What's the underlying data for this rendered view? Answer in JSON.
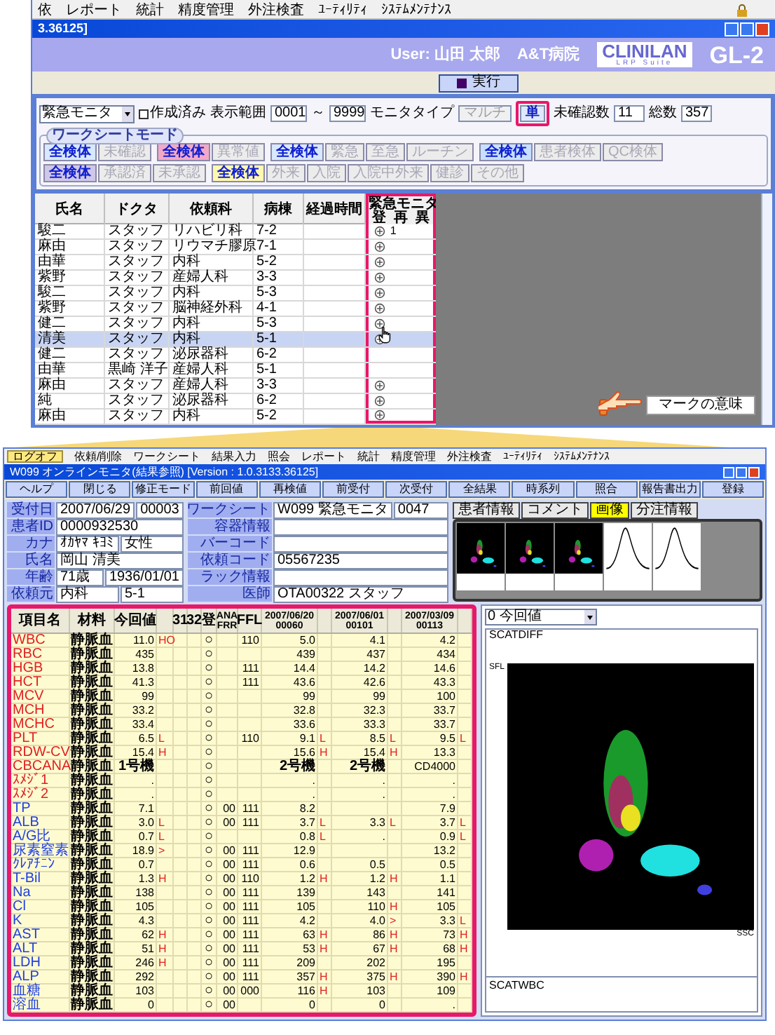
{
  "top_window": {
    "menu": [
      "依",
      "レポート",
      "統計",
      "精度管理",
      "外注検査",
      "ﾕｰﾃｨﾘﾃｨ",
      "ｼｽﾃﾑﾒﾝﾃﾅﾝｽ"
    ],
    "title": "3.36125]",
    "user": "User: 山田 太郎",
    "hospital": "A&T病院",
    "logo": "CLINILAN",
    "logo_sub": "LRP Suite",
    "product": "GL-2",
    "run_button": "実行",
    "filter": {
      "worksheet": "緊急モニタ",
      "created": {
        "label": "作成済み",
        "checked": false
      },
      "range_label": "表示範囲",
      "range_from": "0001",
      "range_sep": "～",
      "range_to": "9999",
      "type_label": "モニタタイプ",
      "types": [
        {
          "label": "マルチ",
          "selected": false
        },
        {
          "label": "単",
          "selected": true
        }
      ],
      "unconfirmed_label": "未確認数",
      "unconfirmed": "11",
      "total_label": "総数",
      "total": "357"
    },
    "mode_group": {
      "title": "ワークシートモード",
      "rows": [
        [
          {
            "color": "#d8e8ff",
            "buttons": [
              {
                "label": "全検体",
                "selected": true
              },
              {
                "label": "未確認",
                "selected": false
              }
            ]
          },
          {
            "color": "#f4a8c8",
            "buttons": [
              {
                "label": "全検体",
                "selected": true
              },
              {
                "label": "異常値",
                "selected": false
              }
            ]
          },
          {
            "color": "#d8e8ff",
            "buttons": [
              {
                "label": "全検体",
                "selected": true
              },
              {
                "label": "緊急",
                "selected": false
              },
              {
                "label": "至急",
                "selected": false
              },
              {
                "label": "ルーチン",
                "selected": false
              }
            ]
          },
          {
            "color": "#c8e0ff",
            "buttons": [
              {
                "label": "全検体",
                "selected": true
              },
              {
                "label": "患者検体",
                "selected": false
              },
              {
                "label": "QC検体",
                "selected": false
              }
            ]
          }
        ],
        [
          {
            "color": "#d0c8e8",
            "buttons": [
              {
                "label": "全検体",
                "selected": true
              },
              {
                "label": "承認済",
                "selected": false
              },
              {
                "label": "未承認",
                "selected": false
              }
            ]
          },
          {
            "color": "#fff8b0",
            "buttons": [
              {
                "label": "全検体",
                "selected": true
              },
              {
                "label": "外来",
                "selected": false
              },
              {
                "label": "入院",
                "selected": false
              },
              {
                "label": "入院中外来",
                "selected": false
              },
              {
                "label": "健診",
                "selected": false
              },
              {
                "label": "その他",
                "selected": false
              }
            ]
          }
        ]
      ]
    },
    "table": {
      "columns": [
        "氏名",
        "ドクタ",
        "依頼科",
        "病棟",
        "経過時間"
      ],
      "monitor_title": "緊急モニタ",
      "monitor_columns": [
        "登",
        "再",
        "異"
      ],
      "rows": [
        {
          "cells": [
            "駿二",
            "スタッフ",
            "リハビリ科",
            "7-2"
          ],
          "mark": true,
          "recheck": "1",
          "selected": false
        },
        {
          "cells": [
            "麻由",
            "スタッフ",
            "リウマチ膠原",
            "7-1"
          ],
          "mark": true,
          "selected": false
        },
        {
          "cells": [
            "由華",
            "スタッフ",
            "内科",
            "5-2"
          ],
          "mark": true,
          "selected": false
        },
        {
          "cells": [
            "紫野",
            "スタッフ",
            "産婦人科",
            "3-3"
          ],
          "mark": true,
          "selected": false
        },
        {
          "cells": [
            "駿二",
            "スタッフ",
            "内科",
            "5-3"
          ],
          "mark": true,
          "selected": false
        },
        {
          "cells": [
            "紫野",
            "スタッフ",
            "脳神経外科",
            "4-1"
          ],
          "mark": true,
          "selected": false
        },
        {
          "cells": [
            "健二",
            "スタッフ",
            "内科",
            "5-3"
          ],
          "mark": true,
          "selected": false
        },
        {
          "cells": [
            "清美",
            "スタッフ",
            "内科",
            "5-1"
          ],
          "mark": true,
          "selected": true
        },
        {
          "cells": [
            "健二",
            "スタッフ",
            "泌尿器科",
            "6-2"
          ],
          "mark": false,
          "selected": false
        },
        {
          "cells": [
            "由華",
            "黒崎 洋子",
            "産婦人科",
            "5-1"
          ],
          "mark": false,
          "selected": false
        },
        {
          "cells": [
            "麻由",
            "スタッフ",
            "産婦人科",
            "3-3"
          ],
          "mark": true,
          "selected": false
        },
        {
          "cells": [
            "純",
            "スタッフ",
            "泌尿器科",
            "6-2"
          ],
          "mark": true,
          "selected": false
        },
        {
          "cells": [
            "麻由",
            "スタッフ",
            "内科",
            "5-2"
          ],
          "mark": true,
          "selected": false
        }
      ]
    },
    "callout": "マークの意味"
  },
  "bottom_window": {
    "logoff": "ログオフ",
    "menu": [
      "依頼/削除",
      "ワークシート",
      "結果入力",
      "照会",
      "レポート",
      "統計",
      "精度管理",
      "外注検査",
      "ﾕｰﾃｨﾘﾃｨ",
      "ｼｽﾃﾑﾒﾝﾃﾅﾝｽ"
    ],
    "title": "W099 オンラインモニタ(結果参照) [Version : 1.0.3133.36125]",
    "toolbar": [
      "ヘルプ",
      "閉じる",
      "修正モード",
      "前回値",
      "再検値",
      "前受付",
      "次受付",
      "全結果",
      "時系列",
      "照合",
      "報告書出力",
      "登録"
    ],
    "info_left": [
      {
        "label": "受付日",
        "values": [
          "2007/06/29",
          "00003"
        ]
      },
      {
        "label": "患者ID",
        "values": [
          "0000932530"
        ]
      },
      {
        "label": "カナ",
        "values": [
          "ｵｶﾔﾏ ｷﾖﾐ",
          "女性"
        ]
      },
      {
        "label": "氏名",
        "values": [
          "岡山 清美"
        ]
      },
      {
        "label": "年齢",
        "values": [
          "71歳",
          "1936/01/01"
        ]
      },
      {
        "label": "依頼元",
        "values": [
          "内科",
          "5-1"
        ]
      }
    ],
    "info_mid": [
      {
        "label": "ワークシート",
        "values": [
          "W099 緊急モニタ",
          "0047"
        ]
      },
      {
        "label": "容器情報"
      },
      {
        "label": "バーコード"
      },
      {
        "label": "依頼コード",
        "values": [
          "05567235"
        ]
      },
      {
        "label": "ラック情報"
      },
      {
        "label": "医師",
        "values": [
          "OTA00322 スタッフ"
        ]
      }
    ],
    "tabs": [
      {
        "label": "患者情報",
        "selected": false
      },
      {
        "label": "コメント",
        "selected": false
      },
      {
        "label": "画像",
        "selected": true
      },
      {
        "label": "分注情報",
        "selected": false
      }
    ],
    "thumbnails": [
      {
        "kind": "scatter"
      },
      {
        "kind": "scatter"
      },
      {
        "kind": "scatter"
      },
      {
        "kind": "curve"
      },
      {
        "kind": "curve"
      }
    ],
    "results": {
      "columns": [
        {
          "kind": "text",
          "label": "項目名"
        },
        {
          "kind": "text",
          "label": "材料"
        },
        {
          "kind": "text",
          "label": "今回値"
        },
        {
          "kind": "flag"
        },
        {
          "kind": "text",
          "label": "31"
        },
        {
          "kind": "text",
          "label": "32"
        },
        {
          "kind": "text",
          "label": "登"
        },
        {
          "kind": "text",
          "label": "ANA",
          "sub": "FRR"
        },
        {
          "kind": "text",
          "label": "FFL"
        },
        {
          "kind": "text",
          "label": "2007/06/20",
          "sub": "00060"
        },
        {
          "kind": "flag"
        },
        {
          "kind": "text",
          "label": "2007/06/01",
          "sub": "00101"
        },
        {
          "kind": "flag"
        },
        {
          "kind": "text",
          "label": "2007/03/09",
          "sub": "00113"
        },
        {
          "kind": "flag"
        }
      ],
      "rows": [
        {
          "name": "WBC",
          "color": "#e02020",
          "cells": {
            "m": "静脈血",
            "v": "11.0",
            "f": "HO",
            "r": "○",
            "ffl": "110",
            "r1": "5.0",
            "r2": "4.1",
            "r3": "4.2"
          }
        },
        {
          "name": "RBC",
          "color": "#e02020",
          "cells": {
            "m": "静脈血",
            "v": "435",
            "r": "○",
            "r1": "439",
            "r2": "437",
            "r3": "434"
          }
        },
        {
          "name": "HGB",
          "color": "#e02020",
          "cells": {
            "m": "静脈血",
            "v": "13.8",
            "r": "○",
            "ffl": "111",
            "r1": "14.4",
            "r2": "14.2",
            "r3": "14.6"
          }
        },
        {
          "name": "HCT",
          "color": "#e02020",
          "cells": {
            "m": "静脈血",
            "v": "41.3",
            "r": "○",
            "ffl": "111",
            "r1": "43.6",
            "r2": "42.6",
            "r3": "43.3"
          }
        },
        {
          "name": "MCV",
          "color": "#e02020",
          "cells": {
            "m": "静脈血",
            "v": "99",
            "r": "○",
            "r1": "99",
            "r2": "99",
            "r3": "100"
          }
        },
        {
          "name": "MCH",
          "color": "#e02020",
          "cells": {
            "m": "静脈血",
            "v": "33.2",
            "r": "○",
            "r1": "32.8",
            "r2": "32.3",
            "r3": "33.7"
          }
        },
        {
          "name": "MCHC",
          "color": "#e02020",
          "cells": {
            "m": "静脈血",
            "v": "33.4",
            "r": "○",
            "r1": "33.6",
            "r2": "33.3",
            "r3": "33.7"
          }
        },
        {
          "name": "PLT",
          "color": "#e02020",
          "cells": {
            "m": "静脈血",
            "v": "6.5",
            "f": "L",
            "r": "○",
            "ffl": "110",
            "r1": "9.1",
            "f1": "L",
            "r2": "8.5",
            "f2": "L",
            "r3": "9.5",
            "f3": "L"
          }
        },
        {
          "name": "RDW-CV",
          "color": "#e02020",
          "cells": {
            "m": "静脈血",
            "v": "15.4",
            "f": "H",
            "r": "○",
            "r1": "15.6",
            "f1": "H",
            "r2": "15.4",
            "f2": "H",
            "r3": "13.3"
          }
        },
        {
          "name": "CBCANA",
          "color": "#e02020",
          "cells": {
            "m": "静脈血",
            "v": "1号機",
            "r": "○",
            "r1": "2号機",
            "r2": "2号機",
            "r3": "CD4000"
          }
        },
        {
          "name": "ｽﾒｼﾞ1",
          "color": "#e02020",
          "cells": {
            "m": "静脈血",
            "v": ".",
            "r": "○",
            "r1": ".",
            "r2": ".",
            "r3": "."
          }
        },
        {
          "name": "ｽﾒｼﾞ2",
          "color": "#e02020",
          "cells": {
            "m": "静脈血",
            "v": ".",
            "r": "○",
            "r1": ".",
            "r2": ".",
            "r3": "."
          }
        },
        {
          "name": "TP",
          "color": "#2040e0",
          "cells": {
            "m": "静脈血",
            "v": "7.1",
            "r": "○",
            "ana": "00",
            "ffl": "111",
            "r1": "8.2",
            "r3": "7.9"
          }
        },
        {
          "name": "ALB",
          "color": "#2040e0",
          "cells": {
            "m": "静脈血",
            "v": "3.0",
            "f": "L",
            "r": "○",
            "ana": "00",
            "ffl": "111",
            "r1": "3.7",
            "f1": "L",
            "r2": "3.3",
            "f2": "L",
            "r3": "3.7",
            "f3": "L"
          }
        },
        {
          "name": "A/G比",
          "color": "#2040e0",
          "cells": {
            "m": "静脈血",
            "v": "0.7",
            "f": "L",
            "r": "○",
            "r1": "0.8",
            "f1": "L",
            "r2": ".",
            "r3": "0.9",
            "f3": "L"
          }
        },
        {
          "name": "尿素窒素",
          "color": "#2040e0",
          "cells": {
            "m": "静脈血",
            "v": "18.9",
            "f": ">",
            "r": "○",
            "ana": "00",
            "ffl": "111",
            "r1": "12.9",
            "r3": "13.2"
          }
        },
        {
          "name": "ｸﾚｱﾁﾆﾝ",
          "color": "#2040e0",
          "cells": {
            "m": "静脈血",
            "v": "0.7",
            "r": "○",
            "ana": "00",
            "ffl": "111",
            "r1": "0.6",
            "r2": "0.5",
            "r3": "0.5"
          }
        },
        {
          "name": "T-Bil",
          "color": "#2040e0",
          "cells": {
            "m": "静脈血",
            "v": "1.3",
            "f": "H",
            "r": "○",
            "ana": "00",
            "ffl": "110",
            "r1": "1.2",
            "f1": "H",
            "r2": "1.2",
            "f2": "H",
            "r3": "1.1"
          }
        },
        {
          "name": "Na",
          "color": "#2040e0",
          "cells": {
            "m": "静脈血",
            "v": "138",
            "r": "○",
            "ana": "00",
            "ffl": "111",
            "r1": "139",
            "r2": "143",
            "r3": "141"
          }
        },
        {
          "name": "Cl",
          "color": "#2040e0",
          "cells": {
            "m": "静脈血",
            "v": "105",
            "r": "○",
            "ana": "00",
            "ffl": "111",
            "r1": "105",
            "r2": "110",
            "f2": "H",
            "r3": "105"
          }
        },
        {
          "name": "K",
          "color": "#2040e0",
          "cells": {
            "m": "静脈血",
            "v": "4.3",
            "r": "○",
            "ana": "00",
            "ffl": "111",
            "r1": "4.2",
            "r2": "4.0",
            "f2": ">",
            "r3": "3.3",
            "f3": "L"
          }
        },
        {
          "name": "AST",
          "color": "#2040e0",
          "cells": {
            "m": "静脈血",
            "v": "62",
            "f": "H",
            "r": "○",
            "ana": "00",
            "ffl": "111",
            "r1": "63",
            "f1": "H",
            "r2": "86",
            "f2": "H",
            "r3": "73",
            "f3": "H"
          }
        },
        {
          "name": "ALT",
          "color": "#2040e0",
          "cells": {
            "m": "静脈血",
            "v": "51",
            "f": "H",
            "r": "○",
            "ana": "00",
            "ffl": "111",
            "r1": "53",
            "f1": "H",
            "r2": "67",
            "f2": "H",
            "r3": "68",
            "f3": "H"
          }
        },
        {
          "name": "LDH",
          "color": "#2040e0",
          "cells": {
            "m": "静脈血",
            "v": "246",
            "f": "H",
            "r": "○",
            "ana": "00",
            "ffl": "111",
            "r1": "209",
            "r2": "202",
            "r3": "195"
          }
        },
        {
          "name": "ALP",
          "color": "#2040e0",
          "cells": {
            "m": "静脈血",
            "v": "292",
            "r": "○",
            "ana": "00",
            "ffl": "111",
            "r1": "357",
            "f1": "H",
            "r2": "375",
            "f2": "H",
            "r3": "390",
            "f3": "H"
          }
        },
        {
          "name": "血糖",
          "color": "#2040e0",
          "cells": {
            "m": "静脈血",
            "v": "103",
            "r": "○",
            "ana": "00",
            "ffl": "000",
            "r1": "116",
            "f1": "H",
            "r2": "103",
            "r3": "109"
          }
        },
        {
          "name": "溶血",
          "color": "#2040e0",
          "cells": {
            "m": "静脈血",
            "v": "0",
            "r": "○",
            "ana": "00",
            "r1": "0",
            "r2": "0",
            "r3": "."
          }
        }
      ]
    },
    "side": {
      "select": "0 今回値",
      "plot_title": "SCATDIFF",
      "y_axis": "SFL",
      "x_axis": "SSC",
      "second_plot": "SCATWBC"
    }
  }
}
